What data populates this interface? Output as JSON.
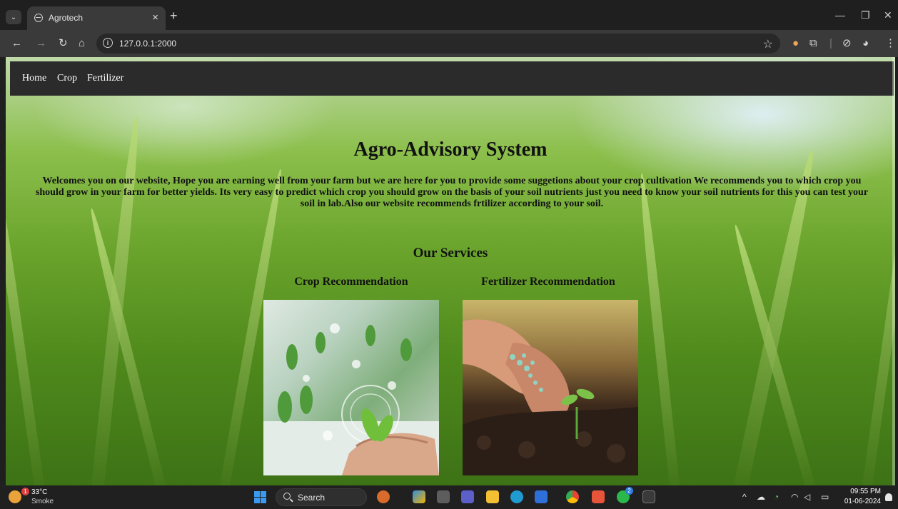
{
  "browser": {
    "tab_title": "Agrotech",
    "tab_close": "×",
    "new_tab": "+",
    "url": "127.0.0.1:2000",
    "menu_glyph": "⌄"
  },
  "nav": {
    "links": [
      "Home",
      "Crop",
      "Fertilizer"
    ]
  },
  "hero": {
    "title": "Agro-Advisory System",
    "intro": "Welcomes you on our website, Hope you are earning well from your farm but we are here for you to provide some suggetions about your crop cultivation We recommends you to which crop you should grow in your farm for better yields. Its very easy to predict which crop you should grow on the basis of your soil nutrients just you need to know your soil nutrients for this you can test your soil in lab.Also our website recommends frtilizer according to your soil."
  },
  "services": {
    "heading": "Our Services",
    "items": [
      {
        "title": "Crop Recommendation"
      },
      {
        "title": "Fertilizer Recommendation"
      }
    ]
  },
  "taskbar": {
    "weather_badge": "1",
    "temperature": "33°C",
    "condition": "Smoke",
    "search_label": "Search",
    "time": "09:55 PM",
    "date": "01-06-2024",
    "whatsapp_badge": "2"
  },
  "colors": {
    "navbar_bg": "#2b2b2b",
    "text_dark": "#111111",
    "taskbar_bg": "#202020",
    "chrome_bg": "#1f1f1f"
  }
}
